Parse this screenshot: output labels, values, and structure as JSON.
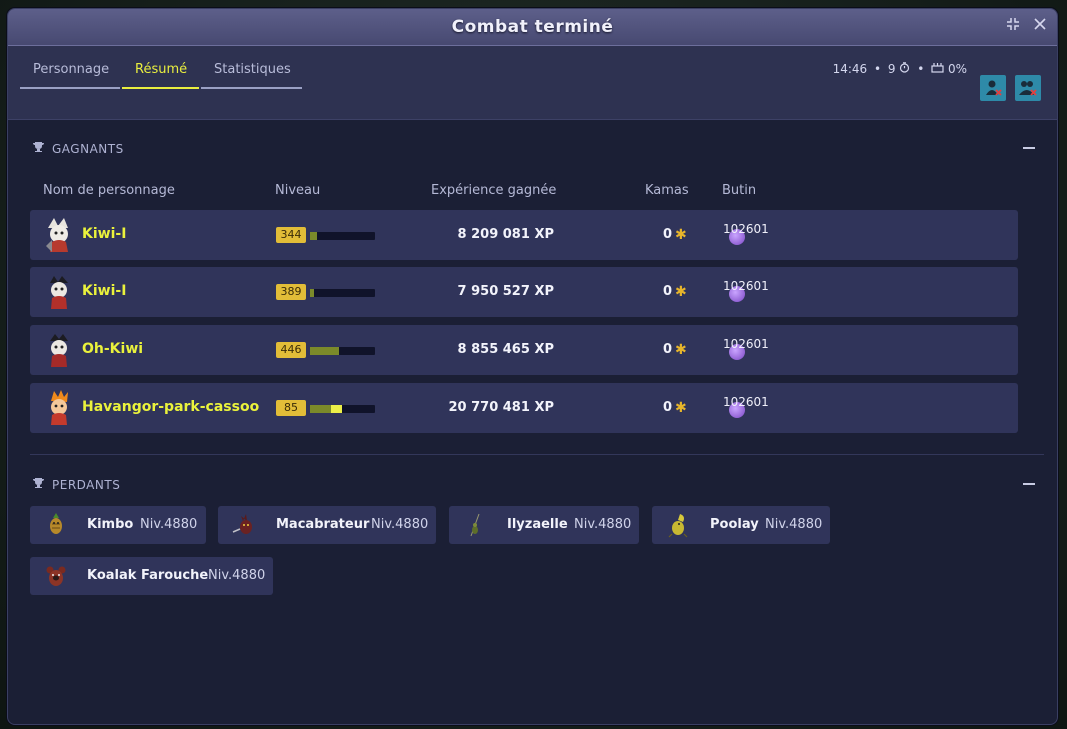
{
  "window": {
    "title": "Combat terminé"
  },
  "tabs": [
    {
      "label": "Personnage",
      "active": false
    },
    {
      "label": "Résumé",
      "active": true
    },
    {
      "label": "Statistiques",
      "active": false
    }
  ],
  "hud": {
    "time": "14:46",
    "turns": "9",
    "percent": "0%"
  },
  "winners": {
    "heading": "GAGNANTS",
    "columns": {
      "name": "Nom de personnage",
      "level": "Niveau",
      "xp": "Expérience gagnée",
      "kamas": "Kamas",
      "loot": "Butin"
    },
    "rows": [
      {
        "name": "Kiwi-I",
        "level": "344",
        "level_progress": 0.1,
        "xp": "8 209 081",
        "xp_unit": "XP",
        "kamas": "0",
        "loot_count": "102601"
      },
      {
        "name": "Kiwi-I",
        "level": "389",
        "level_progress": 0.06,
        "xp": "7 950 527",
        "xp_unit": "XP",
        "kamas": "0",
        "loot_count": "102601"
      },
      {
        "name": "Oh-Kiwi",
        "level": "446",
        "level_progress": 0.45,
        "xp": "8 855 465",
        "xp_unit": "XP",
        "kamas": "0",
        "loot_count": "102601"
      },
      {
        "name": "Havangor-park-cassoo",
        "level": "85",
        "level_progress": 0.32,
        "level_gain": 0.18,
        "xp": "20 770 481",
        "xp_unit": "XP",
        "kamas": "0",
        "loot_count": "102601"
      }
    ]
  },
  "losers": {
    "heading": "PERDANTS",
    "items": [
      {
        "name": "Kimbo",
        "level": "Niv.4880"
      },
      {
        "name": "Macabrateur",
        "level": "Niv.4880"
      },
      {
        "name": "Ilyzaelle",
        "level": "Niv.4880"
      },
      {
        "name": "Poolay",
        "level": "Niv.4880"
      },
      {
        "name": "Koalak Farouche",
        "level": "Niv.4880"
      }
    ]
  },
  "colors": {
    "accent": "#eaf23c",
    "panel": "#30345a",
    "background": "#1b1f35"
  }
}
